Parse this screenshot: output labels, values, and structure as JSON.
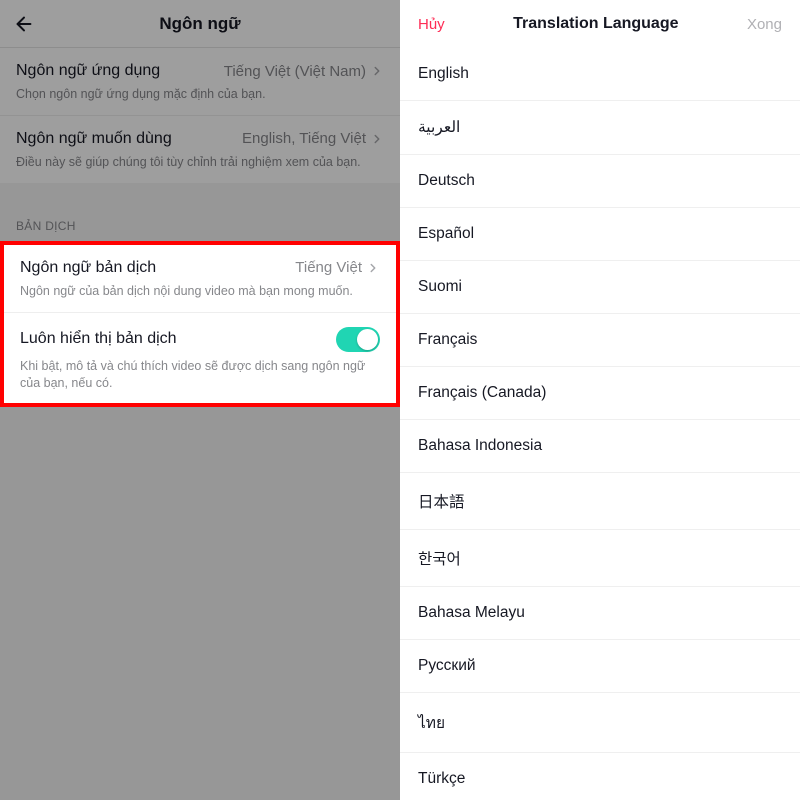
{
  "left": {
    "header_title": "Ngôn ngữ",
    "rows": {
      "app_lang": {
        "label": "Ngôn ngữ ứng dụng",
        "value": "Tiếng Việt (Việt Nam)",
        "desc": "Chọn ngôn ngữ ứng dụng mặc định của bạn."
      },
      "pref_lang": {
        "label": "Ngôn ngữ muốn dùng",
        "value": "English, Tiếng Việt",
        "desc": "Điều này sẽ giúp chúng tôi tùy chỉnh trải nghiệm xem của bạn."
      }
    },
    "section_title": "BẢN DỊCH",
    "highlight": {
      "trans_lang": {
        "label": "Ngôn ngữ bản dịch",
        "value": "Tiếng Việt",
        "desc": "Ngôn ngữ của bản dịch nội dung video mà bạn mong muốn."
      },
      "always_show": {
        "label": "Luôn hiển thị bản dịch",
        "desc": "Khi bật, mô tả và chú thích video sẽ được dịch sang ngôn ngữ của bạn, nếu có."
      }
    }
  },
  "right": {
    "cancel": "Hủy",
    "title": "Translation Language",
    "done": "Xong",
    "languages": [
      "English",
      "العربية",
      "Deutsch",
      "Español",
      "Suomi",
      "Français",
      "Français (Canada)",
      "Bahasa Indonesia",
      "日本語",
      "한국어",
      "Bahasa Melayu",
      "Русский",
      "ไทย",
      "Türkçe"
    ]
  }
}
